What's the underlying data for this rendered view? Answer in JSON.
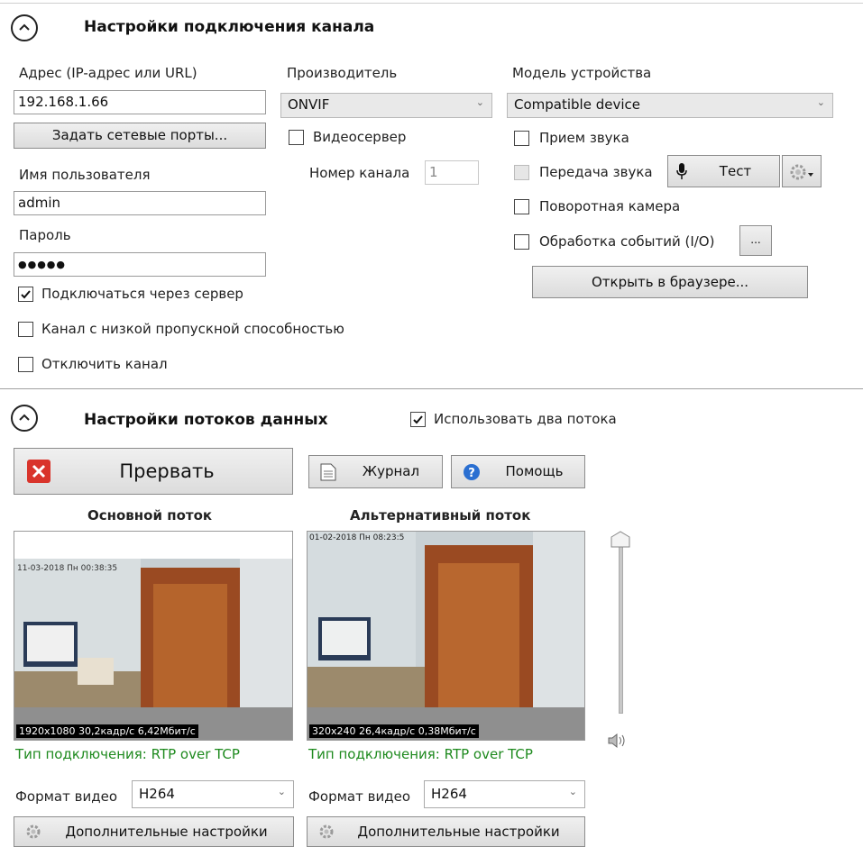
{
  "connection": {
    "title": "Настройки подключения канала",
    "address_label": "Адрес (IP-адрес или URL)",
    "address_value": "192.168.1.66",
    "set_ports_button": "Задать сетевые порты...",
    "username_label": "Имя пользователя",
    "username_value": "admin",
    "password_label": "Пароль",
    "password_value": "●●●●●",
    "connect_via_server": {
      "label": "Подключаться через сервер",
      "checked": true
    },
    "low_bandwidth": {
      "label": "Канал с низкой пропускной способностью",
      "checked": false
    },
    "disable_channel": {
      "label": "Отключить канал",
      "checked": false
    },
    "manufacturer_label": "Производитель",
    "manufacturer_value": "ONVIF",
    "videoserver": {
      "label": "Видеосервер",
      "checked": false
    },
    "channel_number_label": "Номер канала",
    "channel_number_value": "1",
    "model_label": "Модель устройства",
    "model_value": "Compatible device",
    "audio_in": {
      "label": "Прием звука",
      "checked": false
    },
    "audio_out": {
      "label": "Передача звука",
      "checked": false,
      "disabled": true
    },
    "test_button": "Тест",
    "ptz_camera": {
      "label": "Поворотная камера",
      "checked": false
    },
    "event_processing": {
      "label": "Обработка событий (I/O)",
      "checked": false
    },
    "ellipsis_button": "...",
    "open_browser_button": "Открыть в браузере..."
  },
  "streams": {
    "title": "Настройки потоков данных",
    "use_two_streams": {
      "label": "Использовать два потока",
      "checked": true
    },
    "abort_button": "Прервать",
    "journal_button": "Журнал",
    "help_button": "Помощь",
    "main_title": "Основной поток",
    "alt_title": "Альтернативный поток",
    "main_overlay": "1920x1080  30,2кадр/с  6,42Мбит/с",
    "alt_overlay": "320x240  26,4кадр/с  0,38Мбит/с",
    "main_conn_label": "Тип подключения:",
    "main_conn_value": "RTP over TCP",
    "alt_conn_label": "Тип подключения:",
    "alt_conn_value": "RTP over TCP",
    "main_format_label": "Формат видео",
    "main_format_value": "H264",
    "alt_format_label": "Формат видео",
    "alt_format_value": "H264",
    "main_advanced_button": "Дополнительные настройки",
    "alt_advanced_button": "Дополнительные настройки",
    "main_cam_timestamp": "11-03-2018 Пн 00:38:35",
    "alt_cam_timestamp": "01-02-2018 Пн 08:23:5",
    "volume_level": 1.0
  },
  "colors": {
    "green_text": "#1e8a1e",
    "abort_red": "#d9342b",
    "help_blue": "#2a6fd1"
  }
}
